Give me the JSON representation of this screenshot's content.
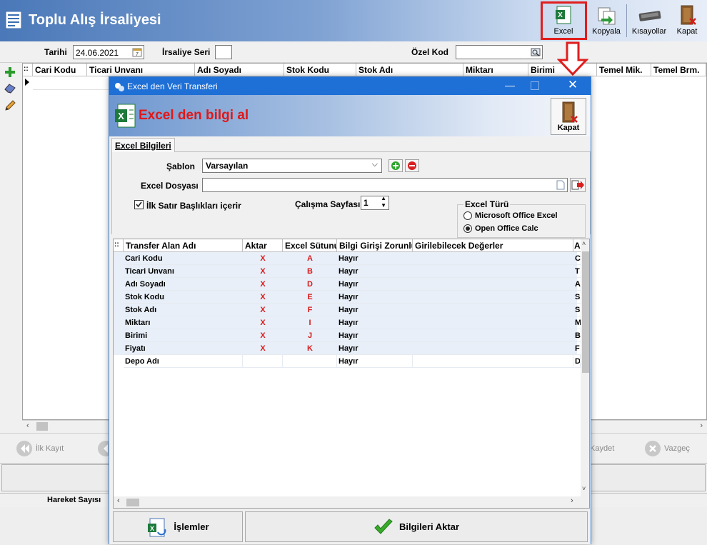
{
  "window": {
    "title": "Toplu Alış İrsaliyesi"
  },
  "toolbar": {
    "excel_label": "Excel",
    "kopyala_label": "Kopyala",
    "kisayollar_label": "Kısayollar",
    "kapat_label": "Kapat"
  },
  "filters": {
    "tarihi_label": "Tarihi",
    "tarihi_value": "24.06.2021",
    "irsaliye_seri_label": "İrsaliye Seri",
    "irsaliye_seri_value": "",
    "ozel_kod_label": "Özel Kod",
    "ozel_kod_value": ""
  },
  "main_grid": {
    "columns": [
      "Cari Kodu",
      "Ticari Unvanı",
      "Adı Soyadı",
      "Stok Kodu",
      "Stok Adı",
      "Miktarı",
      "Birimi",
      "Temel Mik.",
      "Temel Brm."
    ]
  },
  "nav": {
    "first": "İlk Kayıt",
    "save": "Kaydet",
    "cancel": "Vazgeç"
  },
  "status": {
    "hareket_sayisi_label": "Hareket Sayısı"
  },
  "dialog": {
    "title": "Excel den Veri Transferi",
    "header_title": "Excel den bilgi al",
    "kapat_label": "Kapat",
    "tab_label": "Excel Bilgileri",
    "sablon_label": "Şablon",
    "sablon_value": "Varsayılan",
    "excel_dosyasi_label": "Excel Dosyası",
    "excel_dosyasi_value": "",
    "ilk_satir_label": "İlk Satır Başlıkları içerir",
    "ilk_satir_checked": true,
    "calisma_sayfasi_label": "Çalışma Sayfası",
    "calisma_sayfasi_value": "1",
    "excel_turu_label": "Excel Türü",
    "excel_turu_options": [
      "Microsoft Office Excel",
      "Open Office Calc"
    ],
    "excel_turu_selected": "Open Office Calc",
    "grid": {
      "columns": [
        "Transfer Alan Adı",
        "Aktar",
        "Excel Sütunu",
        "Bilgi Girişi Zorunlu",
        "Girilebilecek Değerler",
        "A"
      ],
      "rows": [
        {
          "name": "Cari Kodu",
          "aktar": "X",
          "sutun": "A",
          "zorunlu": "Hayır",
          "degerler": "",
          "extra": "C"
        },
        {
          "name": "Ticari Unvanı",
          "aktar": "X",
          "sutun": "B",
          "zorunlu": "Hayır",
          "degerler": "",
          "extra": "T"
        },
        {
          "name": "Adı Soyadı",
          "aktar": "X",
          "sutun": "D",
          "zorunlu": "Hayır",
          "degerler": "",
          "extra": "A"
        },
        {
          "name": "Stok Kodu",
          "aktar": "X",
          "sutun": "E",
          "zorunlu": "Hayır",
          "degerler": "",
          "extra": "S"
        },
        {
          "name": "Stok Adı",
          "aktar": "X",
          "sutun": "F",
          "zorunlu": "Hayır",
          "degerler": "",
          "extra": "S"
        },
        {
          "name": "Miktarı",
          "aktar": "X",
          "sutun": "I",
          "zorunlu": "Hayır",
          "degerler": "",
          "extra": "M"
        },
        {
          "name": "Birimi",
          "aktar": "X",
          "sutun": "J",
          "zorunlu": "Hayır",
          "degerler": "",
          "extra": "B"
        },
        {
          "name": "Fiyatı",
          "aktar": "X",
          "sutun": "K",
          "zorunlu": "Hayır",
          "degerler": "",
          "extra": "F"
        },
        {
          "name": "Depo Adı",
          "aktar": "",
          "sutun": "",
          "zorunlu": "Hayır",
          "degerler": "",
          "extra": "D"
        }
      ]
    },
    "islemler_label": "İşlemler",
    "aktar_label": "Bilgileri Aktar"
  },
  "colors": {
    "accent": "#1e6fd6",
    "highlight": "#e01e1e"
  }
}
